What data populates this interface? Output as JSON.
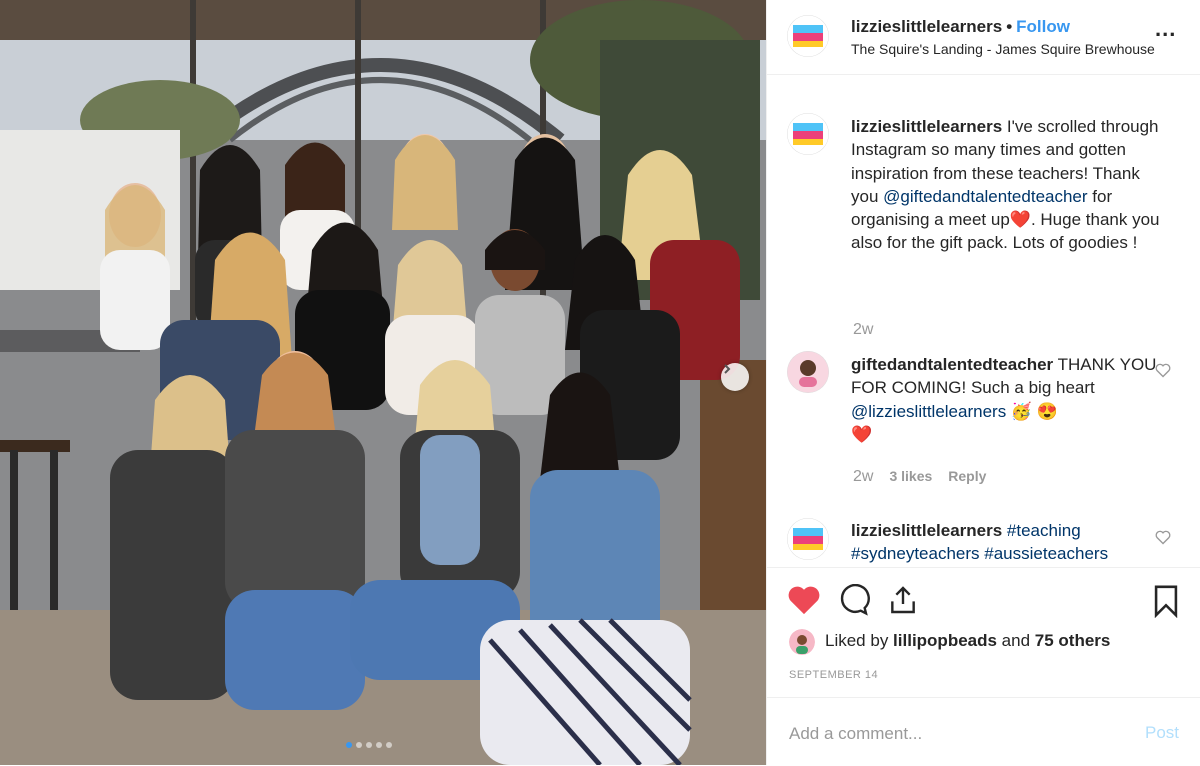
{
  "header": {
    "username": "lizzieslittlelearners",
    "separator": "•",
    "follow_label": "Follow",
    "location": "The Squire's Landing - James Squire Brewhouse",
    "more_label": "..."
  },
  "caption": {
    "username": "lizzieslittlelearners",
    "text_before": " I've scrolled through Instagram so many times and gotten inspiration from these teachers! Thank you ",
    "mention": "@giftedandtalentedteacher",
    "text_after": " for organising a meet up",
    "emoji1": "❤️",
    "text_end": ". Huge thank you also for the gift pack. Lots of goodies !",
    "time": "2w"
  },
  "comments": [
    {
      "username": "giftedandtalentedteacher",
      "text_before": " THANK YOU FOR COMING! Such a big heart ",
      "mention": "@lizzieslittlelearners",
      "emojis": " 🥳 😍",
      "emoji_line2": "❤️",
      "time": "2w",
      "likes": "3 likes",
      "reply": "Reply"
    },
    {
      "username": "lizzieslittlelearners",
      "tag1": "#teaching",
      "tag2": "#sydneyteachers",
      "tag3": "#aussieteachers"
    }
  ],
  "liked_by": {
    "prefix": "Liked by ",
    "user": "lillipopbeads",
    "middle": " and ",
    "others": "75 others"
  },
  "date": "SEPTEMBER 14",
  "add_comment": {
    "placeholder": "Add a comment...",
    "post_label": "Post"
  },
  "colors": {
    "accent": "#3897f0",
    "like_red": "#ed4956",
    "mention": "#003569"
  },
  "carousel": {
    "dots": 5,
    "active_index": 0
  }
}
